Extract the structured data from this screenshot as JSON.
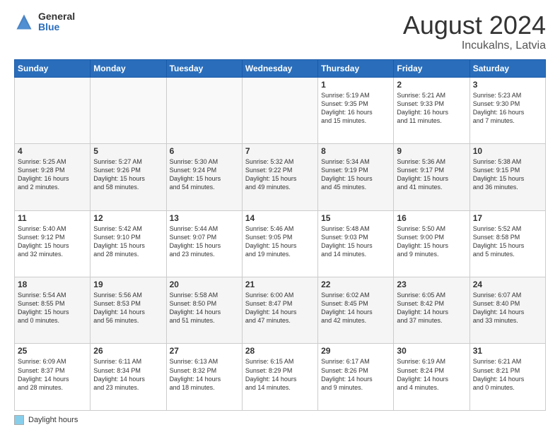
{
  "logo": {
    "general": "General",
    "blue": "Blue"
  },
  "header": {
    "month": "August 2024",
    "location": "Incukalns, Latvia"
  },
  "weekdays": [
    "Sunday",
    "Monday",
    "Tuesday",
    "Wednesday",
    "Thursday",
    "Friday",
    "Saturday"
  ],
  "footer": {
    "legend_label": "Daylight hours"
  },
  "weeks": [
    [
      {
        "day": "",
        "info": ""
      },
      {
        "day": "",
        "info": ""
      },
      {
        "day": "",
        "info": ""
      },
      {
        "day": "",
        "info": ""
      },
      {
        "day": "1",
        "info": "Sunrise: 5:19 AM\nSunset: 9:35 PM\nDaylight: 16 hours\nand 15 minutes."
      },
      {
        "day": "2",
        "info": "Sunrise: 5:21 AM\nSunset: 9:33 PM\nDaylight: 16 hours\nand 11 minutes."
      },
      {
        "day": "3",
        "info": "Sunrise: 5:23 AM\nSunset: 9:30 PM\nDaylight: 16 hours\nand 7 minutes."
      }
    ],
    [
      {
        "day": "4",
        "info": "Sunrise: 5:25 AM\nSunset: 9:28 PM\nDaylight: 16 hours\nand 2 minutes."
      },
      {
        "day": "5",
        "info": "Sunrise: 5:27 AM\nSunset: 9:26 PM\nDaylight: 15 hours\nand 58 minutes."
      },
      {
        "day": "6",
        "info": "Sunrise: 5:30 AM\nSunset: 9:24 PM\nDaylight: 15 hours\nand 54 minutes."
      },
      {
        "day": "7",
        "info": "Sunrise: 5:32 AM\nSunset: 9:22 PM\nDaylight: 15 hours\nand 49 minutes."
      },
      {
        "day": "8",
        "info": "Sunrise: 5:34 AM\nSunset: 9:19 PM\nDaylight: 15 hours\nand 45 minutes."
      },
      {
        "day": "9",
        "info": "Sunrise: 5:36 AM\nSunset: 9:17 PM\nDaylight: 15 hours\nand 41 minutes."
      },
      {
        "day": "10",
        "info": "Sunrise: 5:38 AM\nSunset: 9:15 PM\nDaylight: 15 hours\nand 36 minutes."
      }
    ],
    [
      {
        "day": "11",
        "info": "Sunrise: 5:40 AM\nSunset: 9:12 PM\nDaylight: 15 hours\nand 32 minutes."
      },
      {
        "day": "12",
        "info": "Sunrise: 5:42 AM\nSunset: 9:10 PM\nDaylight: 15 hours\nand 28 minutes."
      },
      {
        "day": "13",
        "info": "Sunrise: 5:44 AM\nSunset: 9:07 PM\nDaylight: 15 hours\nand 23 minutes."
      },
      {
        "day": "14",
        "info": "Sunrise: 5:46 AM\nSunset: 9:05 PM\nDaylight: 15 hours\nand 19 minutes."
      },
      {
        "day": "15",
        "info": "Sunrise: 5:48 AM\nSunset: 9:03 PM\nDaylight: 15 hours\nand 14 minutes."
      },
      {
        "day": "16",
        "info": "Sunrise: 5:50 AM\nSunset: 9:00 PM\nDaylight: 15 hours\nand 9 minutes."
      },
      {
        "day": "17",
        "info": "Sunrise: 5:52 AM\nSunset: 8:58 PM\nDaylight: 15 hours\nand 5 minutes."
      }
    ],
    [
      {
        "day": "18",
        "info": "Sunrise: 5:54 AM\nSunset: 8:55 PM\nDaylight: 15 hours\nand 0 minutes."
      },
      {
        "day": "19",
        "info": "Sunrise: 5:56 AM\nSunset: 8:53 PM\nDaylight: 14 hours\nand 56 minutes."
      },
      {
        "day": "20",
        "info": "Sunrise: 5:58 AM\nSunset: 8:50 PM\nDaylight: 14 hours\nand 51 minutes."
      },
      {
        "day": "21",
        "info": "Sunrise: 6:00 AM\nSunset: 8:47 PM\nDaylight: 14 hours\nand 47 minutes."
      },
      {
        "day": "22",
        "info": "Sunrise: 6:02 AM\nSunset: 8:45 PM\nDaylight: 14 hours\nand 42 minutes."
      },
      {
        "day": "23",
        "info": "Sunrise: 6:05 AM\nSunset: 8:42 PM\nDaylight: 14 hours\nand 37 minutes."
      },
      {
        "day": "24",
        "info": "Sunrise: 6:07 AM\nSunset: 8:40 PM\nDaylight: 14 hours\nand 33 minutes."
      }
    ],
    [
      {
        "day": "25",
        "info": "Sunrise: 6:09 AM\nSunset: 8:37 PM\nDaylight: 14 hours\nand 28 minutes."
      },
      {
        "day": "26",
        "info": "Sunrise: 6:11 AM\nSunset: 8:34 PM\nDaylight: 14 hours\nand 23 minutes."
      },
      {
        "day": "27",
        "info": "Sunrise: 6:13 AM\nSunset: 8:32 PM\nDaylight: 14 hours\nand 18 minutes."
      },
      {
        "day": "28",
        "info": "Sunrise: 6:15 AM\nSunset: 8:29 PM\nDaylight: 14 hours\nand 14 minutes."
      },
      {
        "day": "29",
        "info": "Sunrise: 6:17 AM\nSunset: 8:26 PM\nDaylight: 14 hours\nand 9 minutes."
      },
      {
        "day": "30",
        "info": "Sunrise: 6:19 AM\nSunset: 8:24 PM\nDaylight: 14 hours\nand 4 minutes."
      },
      {
        "day": "31",
        "info": "Sunrise: 6:21 AM\nSunset: 8:21 PM\nDaylight: 14 hours\nand 0 minutes."
      }
    ]
  ]
}
